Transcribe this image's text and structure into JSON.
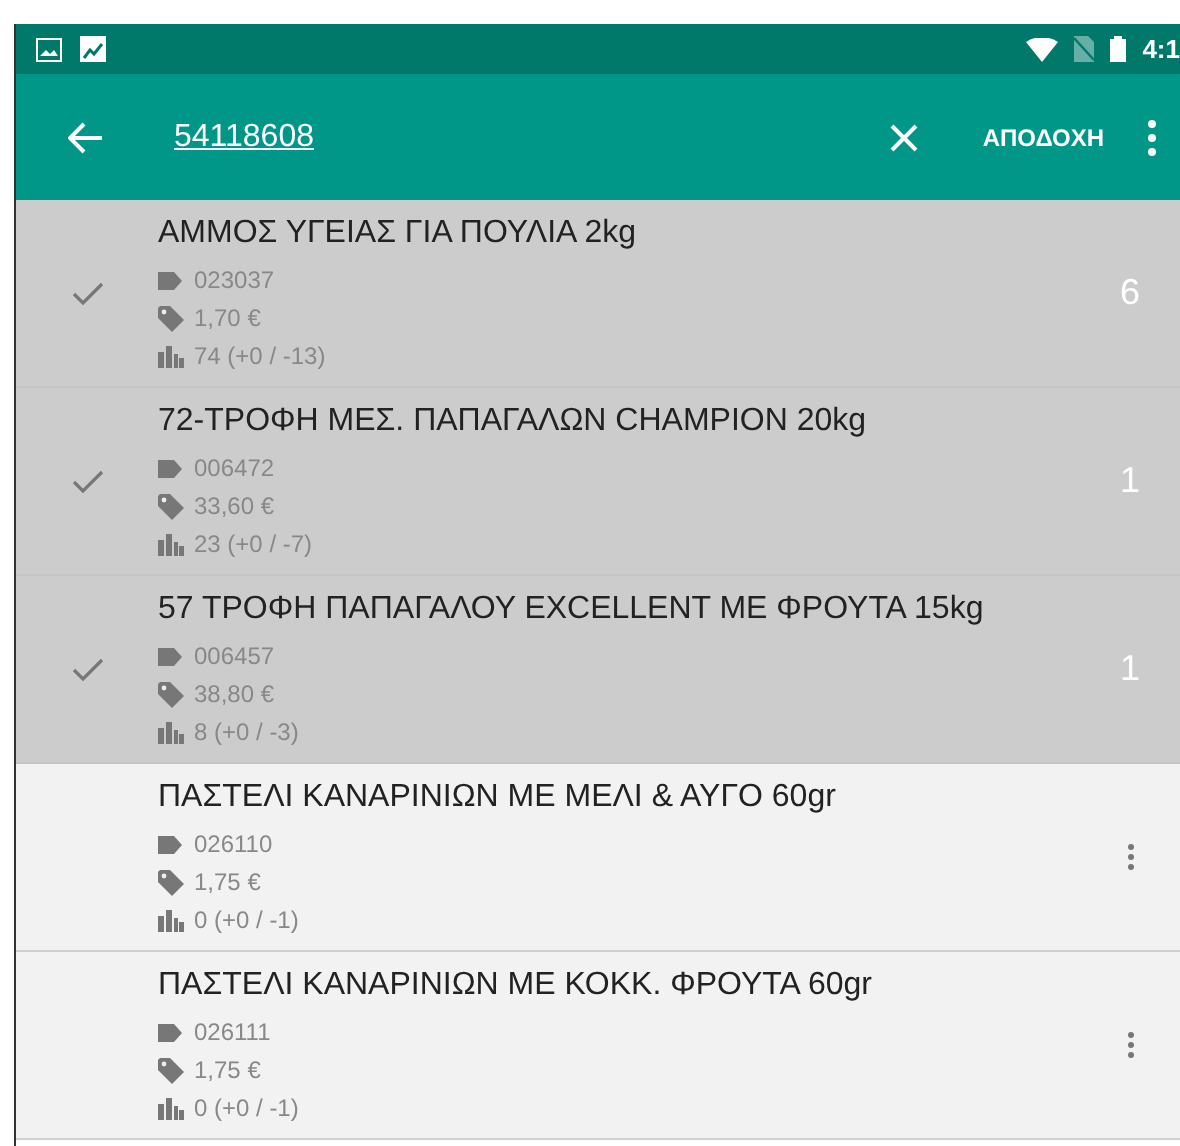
{
  "status_bar": {
    "time": "4:1"
  },
  "app_bar": {
    "query": "54118608",
    "action": "ΑΠΟΔΟΧΗ"
  },
  "items": [
    {
      "title": "ΑΜΜΟΣ ΥΓΕΙΑΣ ΓΙΑ ΠΟΥΛΙΑ 2kg",
      "code": "023037",
      "price": "1,70 €",
      "stock": "74 (+0 / -13)",
      "checked": true,
      "count": "6"
    },
    {
      "title": "72-ΤΡΟΦΗ ΜΕΣ. ΠΑΠΑΓΑΛΩΝ CHAMPION 20kg",
      "code": "006472",
      "price": "33,60 €",
      "stock": "23 (+0 / -7)",
      "checked": true,
      "count": "1"
    },
    {
      "title": "57 ΤΡΟΦΗ ΠΑΠΑΓΑΛΟΥ EXCELLENT ΜΕ ΦΡΟΥΤΑ 15kg",
      "code": "006457",
      "price": "38,80 €",
      "stock": "8 (+0 / -3)",
      "checked": true,
      "count": "1"
    },
    {
      "title": "ΠΑΣΤΕΛΙ ΚΑΝΑΡΙΝΙΩΝ ΜΕ ΜΕΛΙ & ΑΥΓΟ 60gr",
      "code": "026110",
      "price": "1,75 €",
      "stock": "0 (+0 / -1)",
      "checked": false
    },
    {
      "title": "ΠΑΣΤΕΛΙ ΚΑΝΑΡΙΝΙΩΝ ΜΕ ΚΟΚΚ. ΦΡΟΥΤΑ 60gr",
      "code": "026111",
      "price": "1,75 €",
      "stock": "0 (+0 / -1)",
      "checked": false
    }
  ]
}
